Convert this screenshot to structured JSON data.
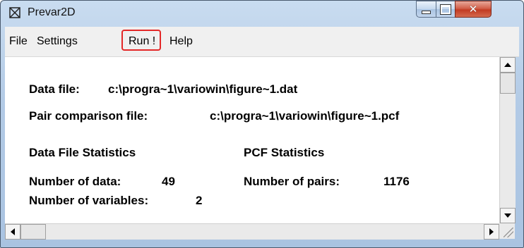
{
  "window": {
    "title": "Prevar2D",
    "app_icon": "crossed-box-icon"
  },
  "titlebar_buttons": {
    "minimize": "minimize-icon",
    "maximize": "maximize-icon",
    "close": "close-icon"
  },
  "menu": {
    "file": "File",
    "settings": "Settings",
    "run": "Run !",
    "help": "Help",
    "highlight_color": "#e32828"
  },
  "content": {
    "data_file_label": "Data file:",
    "data_file_value": "c:\\progra~1\\variowin\\figure~1.dat",
    "pair_file_label": "Pair comparison file:",
    "pair_file_value": "c:\\progra~1\\variowin\\figure~1.pcf",
    "data_stats_heading": "Data File Statistics",
    "pcf_stats_heading": "PCF Statistics",
    "num_data_label": "Number of data:",
    "num_data_value": "49",
    "num_vars_label": "Number of variables:",
    "num_vars_value": "2",
    "num_pairs_label": "Number of pairs:",
    "num_pairs_value": "1176"
  }
}
